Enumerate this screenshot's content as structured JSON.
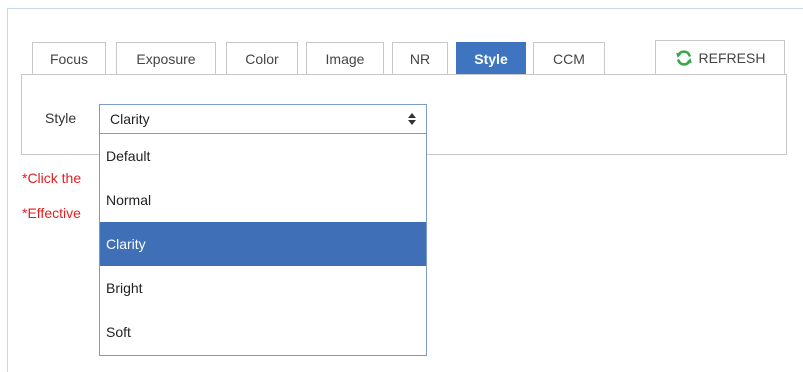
{
  "tabs": [
    {
      "label": "Focus",
      "active": false
    },
    {
      "label": "Exposure",
      "active": false
    },
    {
      "label": "Color",
      "active": false
    },
    {
      "label": "Image",
      "active": false
    },
    {
      "label": "NR",
      "active": false
    },
    {
      "label": "Style",
      "active": true
    },
    {
      "label": "CCM",
      "active": false
    }
  ],
  "refresh": {
    "label": "REFRESH",
    "icon": "refresh-icon"
  },
  "style_field": {
    "label": "Style",
    "selected": "Clarity",
    "options": [
      "Default",
      "Normal",
      "Clarity",
      "Bright",
      "Soft"
    ]
  },
  "notes": [
    "*Click the",
    "*Effective"
  ],
  "colors": {
    "active_tab": "#3e74c0",
    "selected_option": "#3f6fb7",
    "note_text": "#e02020",
    "refresh_icon": "#3aa54a"
  }
}
